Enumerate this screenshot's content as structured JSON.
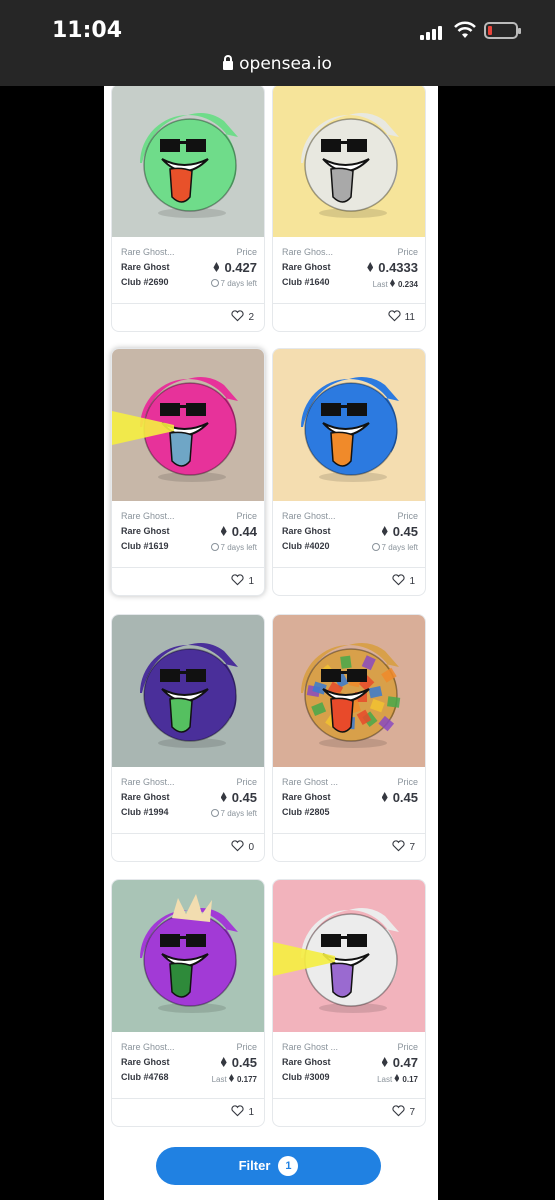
{
  "status": {
    "time": "11:04",
    "url": "opensea.io"
  },
  "filter": {
    "label": "Filter",
    "count": "1"
  },
  "price_label": "Price",
  "cards": [
    {
      "collection": "Rare Ghost...",
      "name_line1": "Rare Ghost",
      "name_line2": "Club #2690",
      "price": "0.427",
      "sub_type": "time",
      "sub_text": "7 days left",
      "likes": "2",
      "bg": "#c6cec9",
      "body": "#6fdc8a",
      "tongue": "#e8512a",
      "art": "green-glass-ghost"
    },
    {
      "collection": "Rare Ghos...",
      "name_line1": "Rare Ghost",
      "name_line2": "Club #1640",
      "price": "0.4333",
      "sub_type": "last",
      "sub_label": "Last",
      "sub_value": "0.234",
      "likes": "11",
      "bg": "#f6e49a",
      "body": "#e8e8e0",
      "tongue": "#a9a9a9",
      "art": "lightbulb-ghost"
    },
    {
      "collection": "Rare Ghost...",
      "name_line1": "Rare Ghost",
      "name_line2": "Club #1619",
      "price": "0.44",
      "sub_type": "time",
      "sub_text": "7 days left",
      "likes": "1",
      "bg": "#c7b7a8",
      "body": "#e7329a",
      "tongue": "#6fa6c6",
      "art": "pink-laser-ghost"
    },
    {
      "collection": "Rare Ghost...",
      "name_line1": "Rare Ghost",
      "name_line2": "Club #4020",
      "price": "0.45",
      "sub_type": "time",
      "sub_text": "7 days left",
      "likes": "1",
      "bg": "#f4ddb0",
      "body": "#2c7ae0",
      "tongue": "#f08a2a",
      "art": "blue-ghost"
    },
    {
      "collection": "Rare Ghost...",
      "name_line1": "Rare Ghost",
      "name_line2": "Club #1994",
      "price": "0.45",
      "sub_type": "time",
      "sub_text": "7 days left",
      "likes": "0",
      "bg": "#a9b6b2",
      "body": "#4a2f9a",
      "tongue": "#55c060",
      "art": "purple-galaxy-ghost"
    },
    {
      "collection": "Rare Ghost ...",
      "name_line1": "Rare Ghost",
      "name_line2": "Club #2805",
      "price": "0.45",
      "sub_type": "none",
      "likes": "7",
      "bg": "#d9ae98",
      "body": "#d8a04a",
      "tongue": "#e84a2a",
      "art": "mosaic-ghost"
    },
    {
      "collection": "Rare Ghost...",
      "name_line1": "Rare Ghost",
      "name_line2": "Club #4768",
      "price": "0.45",
      "sub_type": "last",
      "sub_label": "Last",
      "sub_value": "0.177",
      "likes": "1",
      "bg": "#a9c4b6",
      "body": "#a23ad6",
      "tongue": "#2e8a3a",
      "art": "fire-ghost"
    },
    {
      "collection": "Rare Ghost ...",
      "name_line1": "Rare Ghost",
      "name_line2": "Club #3009",
      "price": "0.47",
      "sub_type": "last",
      "sub_label": "Last",
      "sub_value": "0.17",
      "likes": "7",
      "bg": "#f2b3bc",
      "body": "#ececec",
      "tongue": "#9a6ad0",
      "art": "marble-laser-ghost"
    }
  ]
}
